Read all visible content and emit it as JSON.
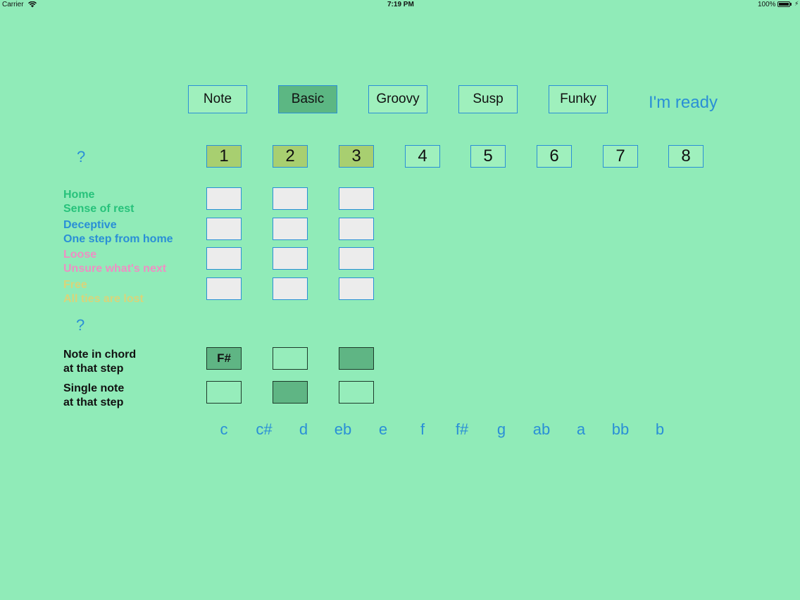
{
  "status_bar": {
    "carrier": "Carrier",
    "time": "7:19 PM",
    "battery": "100%"
  },
  "modes": [
    {
      "label": "Note",
      "selected": false
    },
    {
      "label": "Basic",
      "selected": true
    },
    {
      "label": "Groovy",
      "selected": false
    },
    {
      "label": "Susp",
      "selected": false
    },
    {
      "label": "Funky",
      "selected": false
    }
  ],
  "ready_label": "I'm ready",
  "help_top": "?",
  "help_mid": "?",
  "steps": [
    {
      "label": "1",
      "active": true
    },
    {
      "label": "2",
      "active": true
    },
    {
      "label": "3",
      "active": true
    },
    {
      "label": "4",
      "active": false
    },
    {
      "label": "5",
      "active": false
    },
    {
      "label": "6",
      "active": false
    },
    {
      "label": "7",
      "active": false
    },
    {
      "label": "8",
      "active": false
    }
  ],
  "moods": {
    "home": {
      "line1": "Home",
      "line2": "Sense of rest",
      "color": "#27c27b"
    },
    "deceptive": {
      "line1": "Deceptive",
      "line2": "One step from home",
      "color": "#2a8fd6"
    },
    "loose": {
      "line1": "Loose",
      "line2": "Unsure what's next",
      "color": "#ee8fc4"
    },
    "free": {
      "line1": "Free",
      "line2": "All ties are lost",
      "color": "#d9d47a"
    }
  },
  "chord_row": {
    "line1": "Note in chord",
    "line2": "at that step",
    "cells": [
      "F#",
      "",
      ""
    ]
  },
  "single_row": {
    "line1": "Single note",
    "line2": "at that step"
  },
  "note_keys": [
    "c",
    "c#",
    "d",
    "eb",
    "e",
    "f",
    "f#",
    "g",
    "ab",
    "a",
    "bb",
    "b"
  ],
  "colors": {
    "background": "#90ebb8",
    "accent": "#2a8fd6",
    "selected": "#5cb783",
    "active_step": "#a8cf70"
  }
}
